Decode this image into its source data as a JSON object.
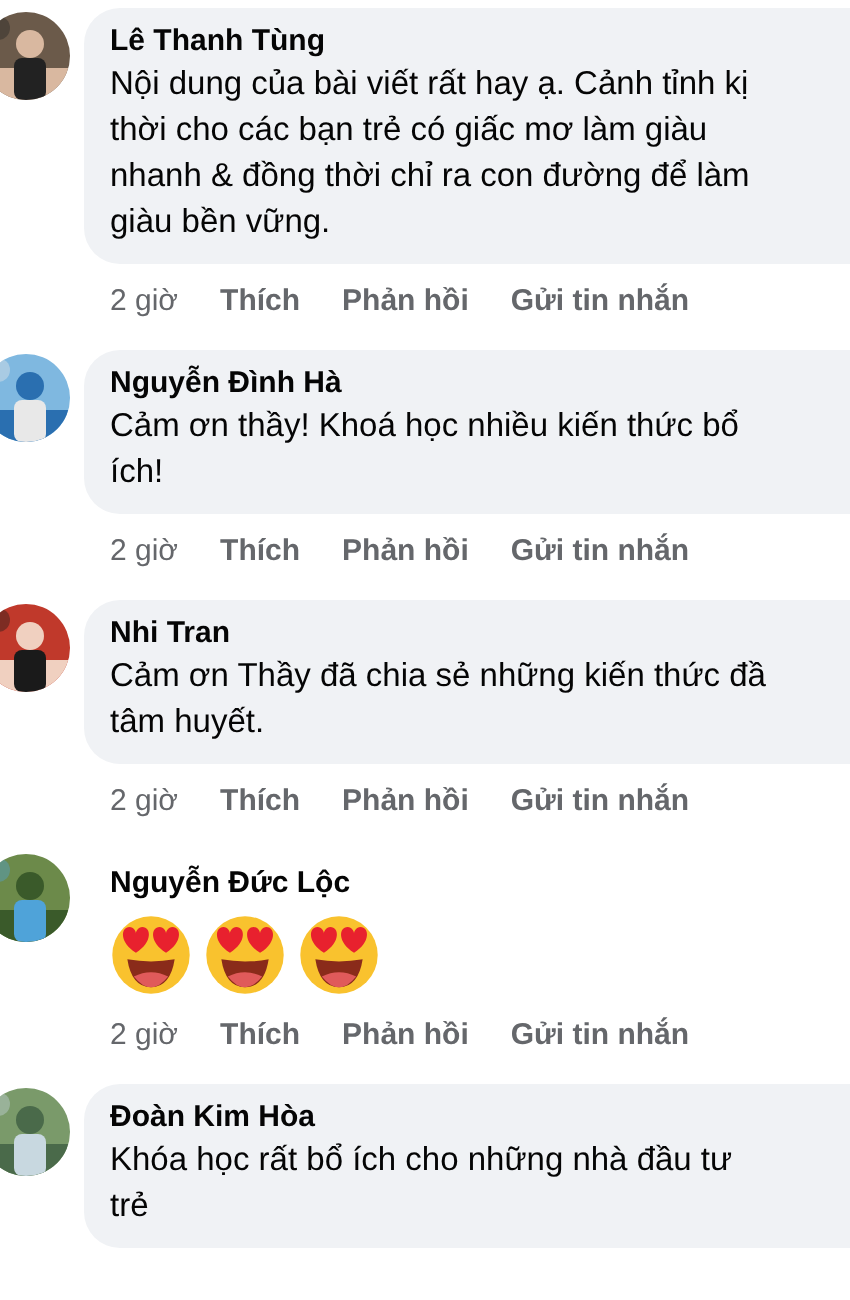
{
  "comments": [
    {
      "author": "Lê Thanh Tùng",
      "kind": "text",
      "text": "Nội dung của bài viết rất hay ạ. Cảnh tỉnh kị\nthời cho các bạn trẻ có giấc mơ làm giàu\nnhanh & đồng thời chỉ ra con đường để làm\ngiàu bền vững.",
      "avatar": {
        "kind": "picture"
      },
      "actions": [
        {
          "label": "2 giờ",
          "kind": "time"
        },
        {
          "label": "Thích",
          "kind": "link"
        },
        {
          "label": "Phản hồi",
          "kind": "link"
        },
        {
          "label": "Gửi tin nhắn",
          "kind": "link"
        }
      ]
    },
    {
      "author": "Nguyễn Đình Hà",
      "kind": "text",
      "text": "Cảm ơn thầy! Khoá học nhiều kiến thức bổ\ních!",
      "avatar": {
        "kind": "picture"
      },
      "actions": [
        {
          "label": "2 giờ",
          "kind": "time"
        },
        {
          "label": "Thích",
          "kind": "link"
        },
        {
          "label": "Phản hồi",
          "kind": "link"
        },
        {
          "label": "Gửi tin nhắn",
          "kind": "link"
        }
      ]
    },
    {
      "author": "Nhi Tran",
      "kind": "text",
      "text": "Cảm ơn Thầy đã chia sẻ những kiến thức đầ\ntâm huyết.",
      "avatar": {
        "kind": "picture"
      },
      "actions": [
        {
          "label": "2 giờ",
          "kind": "time"
        },
        {
          "label": "Thích",
          "kind": "link"
        },
        {
          "label": "Phản hồi",
          "kind": "link"
        },
        {
          "label": "Gửi tin nhắn",
          "kind": "link"
        }
      ]
    },
    {
      "author": "Nguyễn Đức Lộc",
      "kind": "emoji",
      "emojis": [
        {
          "kind": "heart-eyes"
        },
        {
          "kind": "heart-eyes"
        },
        {
          "kind": "heart-eyes"
        }
      ],
      "avatar": {
        "kind": "picture"
      },
      "actions": [
        {
          "label": "2 giờ",
          "kind": "time"
        },
        {
          "label": "Thích",
          "kind": "link"
        },
        {
          "label": "Phản hồi",
          "kind": "link"
        },
        {
          "label": "Gửi tin nhắn",
          "kind": "link"
        }
      ]
    },
    {
      "author": "Đoàn Kim Hòa",
      "kind": "text",
      "text": "Khóa học rất bổ ích cho những nhà đầu tư\ntrẻ",
      "avatar": {
        "kind": "picture"
      }
    }
  ]
}
